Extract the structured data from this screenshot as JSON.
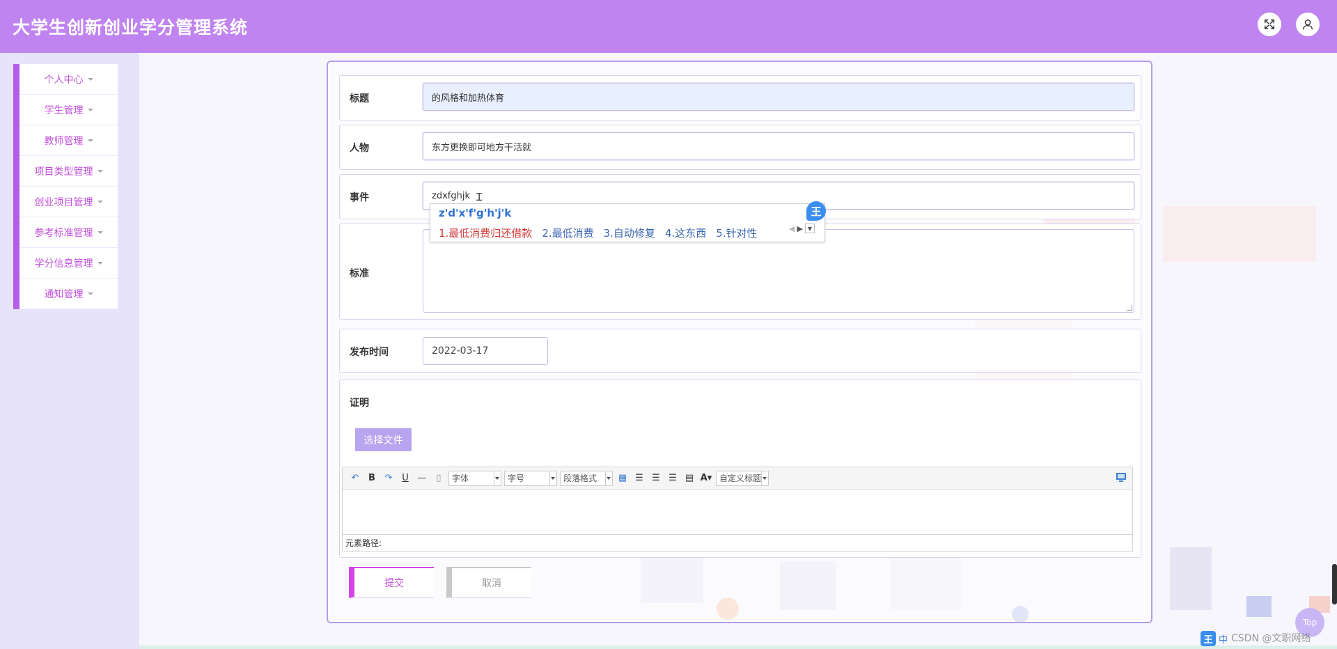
{
  "app": {
    "title": "大学生创新创业学分管理系统"
  },
  "header": {
    "icons": [
      "fullscreen-icon",
      "user-icon"
    ]
  },
  "sidebar": {
    "items": [
      {
        "label": "个人中心"
      },
      {
        "label": "学生管理"
      },
      {
        "label": "教师管理"
      },
      {
        "label": "项目类型管理"
      },
      {
        "label": "创业项目管理"
      },
      {
        "label": "参考标准管理"
      },
      {
        "label": "学分信息管理"
      },
      {
        "label": "通知管理"
      }
    ]
  },
  "form": {
    "title": {
      "label": "标题",
      "value": "的风格和加热体育"
    },
    "person": {
      "label": "人物",
      "value": "东方更换即可地方干活就"
    },
    "event": {
      "label": "事件",
      "value": "zdxfghjk"
    },
    "standard": {
      "label": "标准",
      "value": ""
    },
    "publish_time": {
      "label": "发布时间",
      "value": "2022-03-17"
    },
    "proof": {
      "label": "证明",
      "file_button": "选择文件"
    },
    "submit": "提交",
    "cancel": "取消"
  },
  "ime": {
    "composition": "z'd'x'f'g'h'j'k",
    "candidates": [
      "1.最低消费归还借款",
      "2.最低消费",
      "3.自动修复",
      "4.这东西",
      "5.针对性"
    ],
    "logo": "王"
  },
  "editor": {
    "font_select": "字体",
    "size_select": "字号",
    "paragraph_select": "段落格式",
    "custom_title_select": "自定义标题",
    "element_path": "元素路径:"
  },
  "misc": {
    "top_button": "Top",
    "watermark": "CSDN @文职网络",
    "tray_logo": "王",
    "tray_lang": "中"
  },
  "colors": {
    "header": "#c084f0",
    "accent": "#b45ee8",
    "submit": "#d542e8"
  }
}
